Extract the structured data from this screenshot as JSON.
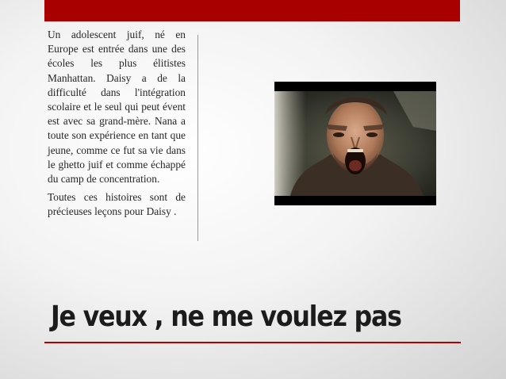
{
  "slide": {
    "paragraphs": [
      "Un adolescent juif, né en Europe est entrée dans une des écoles les plus élitistes Manhattan. Daisy a de la difficulté dans l'intégration scolaire et le seul qui peut évent est avec sa grand-mère. Nana a toute son expérience en tant que jeune, comme ce fut sa vie dans le ghetto juif et comme échappé du camp de concentration.",
      "Toutes ces histoires sont de précieuses leçons pour Daisy ."
    ],
    "title": "Je veux , ne me voulez pas"
  },
  "colors": {
    "accent_bar": "#a80000",
    "accent_line": "#b30000",
    "body_text": "#262626",
    "title_text": "#1c1c1c"
  },
  "media": {
    "video_frame_icon": "screaming-man-video-still"
  }
}
